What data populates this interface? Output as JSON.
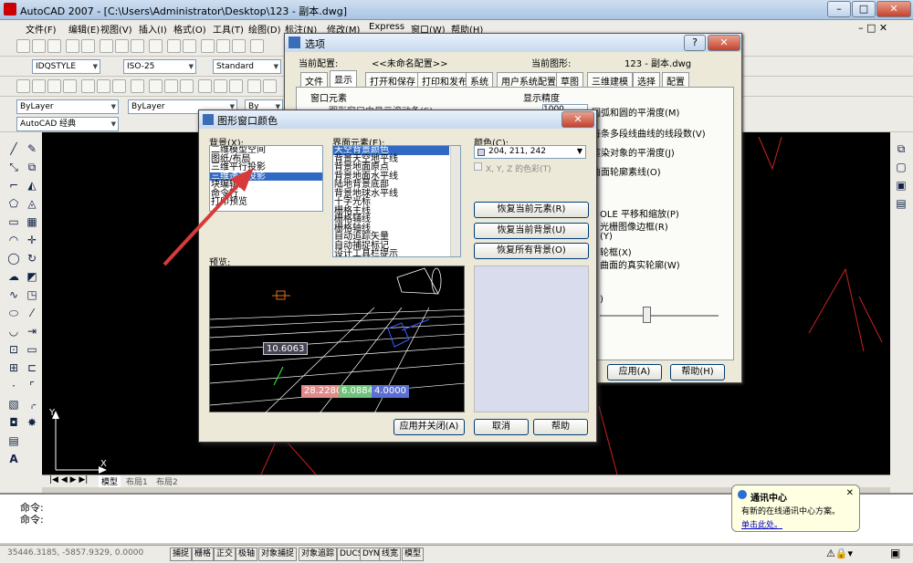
{
  "app": {
    "title": "AutoCAD 2007 - [C:\\Users\\Administrator\\Desktop\\123 - 副本.dwg]"
  },
  "menu": [
    "文件(F)",
    "编辑(E)",
    "视图(V)",
    "插入(I)",
    "格式(O)",
    "工具(T)",
    "绘图(D)",
    "标注(N)",
    "修改(M)",
    "Express",
    "窗口(W)",
    "帮助(H)"
  ],
  "toolbar": {
    "text_style": "IDQSTYLE",
    "dim_style": "ISO-25",
    "table_style": "Standard",
    "layer": "ByLayer",
    "linetype": "ByLayer",
    "lineweight": "By",
    "workspace": "AutoCAD 经典"
  },
  "layout_tabs": [
    "模型",
    "布局1",
    "布局2"
  ],
  "command": {
    "line1": "命令:",
    "line2": "命令:"
  },
  "status": {
    "coords": "35446.3185, -5857.9329, 0.0000",
    "buttons": [
      "捕捉",
      "栅格",
      "正交",
      "极轴",
      "对象捕捉",
      "对象追踪",
      "DUCS",
      "DYN",
      "线宽",
      "模型"
    ]
  },
  "ucs": {
    "x": "X",
    "y": "Y"
  },
  "options": {
    "title": "选项",
    "current_profile_label": "当前配置:",
    "current_profile": "<<未命名配置>>",
    "current_drawing_label": "当前图形:",
    "current_drawing": "123 - 副本.dwg",
    "tabs": [
      "文件",
      "显示",
      "打开和保存",
      "打印和发布",
      "系统",
      "用户系统配置",
      "草图",
      "三维建模",
      "选择",
      "配置"
    ],
    "window_elements": "窗口元素",
    "window_first": "图形窗口中显示滚动条(S)",
    "display_precision": "显示精度",
    "precision_items": [
      "圆弧和圆的平滑度(M)",
      "每条多段线曲线的线段数(V)",
      "渲染对象的平滑度(J)",
      "曲面轮廓素线(O)"
    ],
    "precision_value": "1000",
    "performance_items": [
      "OLE 平移和缩放(P)",
      "光栅图像边框(R)",
      "(Y)",
      "轮框(X)",
      "曲面的真实轮廓(W)"
    ],
    "fade_value": ")",
    "apply": "应用(A)",
    "help": "帮助(H)"
  },
  "color_dialog": {
    "title": "图形窗口颜色",
    "context_label": "背景(X):",
    "contexts": [
      "二维模型空间",
      "图纸/布局",
      "三维平行投影",
      "三维透视投影",
      "块编辑器",
      "命令行",
      "打印预览"
    ],
    "context_selected": 3,
    "element_label": "界面元素(E):",
    "elements": [
      "天空背景颜色",
      "背景天空地平线",
      "背景地面原点",
      "背景地面水平线",
      "陆地背景底部",
      "背景地球水平线",
      "十字光标",
      "栅格主线",
      "栅格辅线",
      "栅格轴线",
      "自动追踪矢量",
      "自动捕捉标记",
      "设计工具栏提示"
    ],
    "element_selected": 0,
    "color_label": "颜色(C):",
    "color_value": "204, 211, 242",
    "color_swatch": "#ccd3f2",
    "tint_label": "X, Y, Z 的色彩(T)",
    "restore_element": "恢复当前元素(R)",
    "restore_context": "恢复当前背景(U)",
    "restore_all": "恢复所有背景(O)",
    "preview_label": "预览:",
    "preview_values": [
      "10.6063",
      "28.2280",
      "6.0884",
      "4.0000"
    ],
    "apply_close": "应用并关闭(A)",
    "cancel": "取消",
    "help": "帮助"
  },
  "balloon": {
    "title": "通讯中心",
    "body": "有新的在线通讯中心方案。",
    "link": "单击此处。"
  },
  "colors": {
    "accent_red": "#d73a3a",
    "selection": "#316ac5",
    "tag_red": "#e08a8a",
    "tag_green": "#6fc27a",
    "tag_blue": "#5a6fd1"
  }
}
